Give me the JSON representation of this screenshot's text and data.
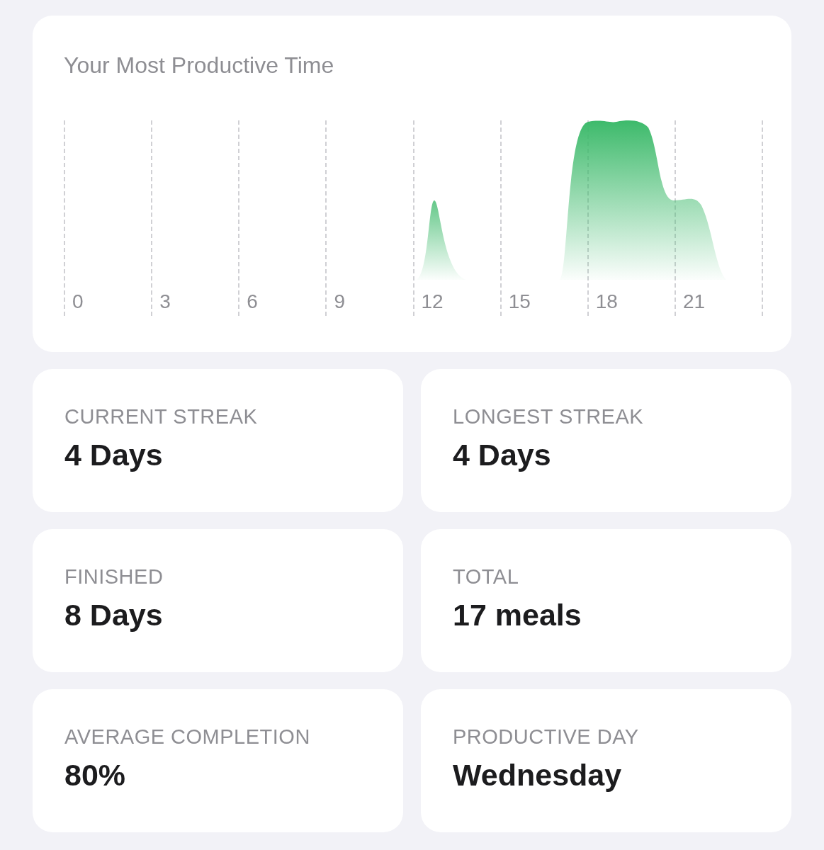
{
  "chart_card": {
    "title": "Your Most Productive Time",
    "x_labels": [
      "0",
      "3",
      "6",
      "9",
      "12",
      "15",
      "18",
      "21"
    ]
  },
  "stats": [
    {
      "label": "CURRENT STREAK",
      "value": "4 Days"
    },
    {
      "label": "LONGEST STREAK",
      "value": "4 Days"
    },
    {
      "label": "FINISHED",
      "value": "8 Days"
    },
    {
      "label": "TOTAL",
      "value": "17 meals"
    },
    {
      "label": "AVERAGE COMPLETION",
      "value": "80%"
    },
    {
      "label": "PRODUCTIVE DAY",
      "value": "Wednesday"
    }
  ]
}
